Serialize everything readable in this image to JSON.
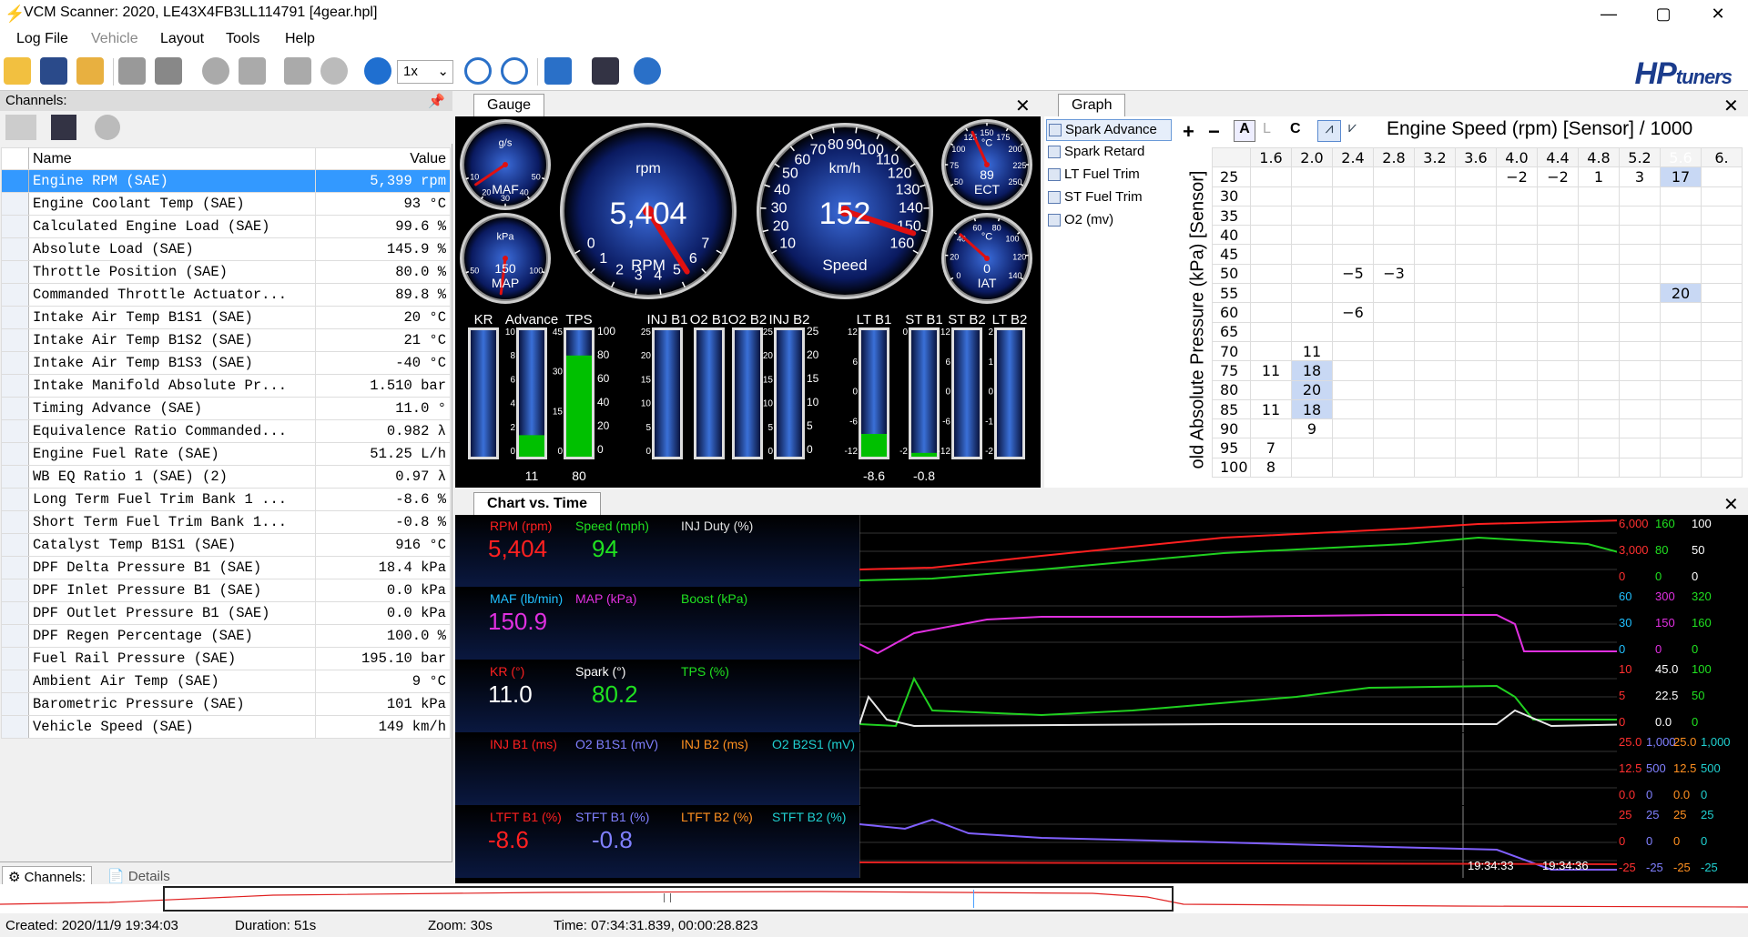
{
  "window": {
    "title": "VCM Scanner: 2020, LE43X4FB3LL114791 [4gear.hpl]",
    "minimize": "—",
    "maximize": "▢",
    "close": "✕"
  },
  "menu": [
    "Log File",
    "Vehicle",
    "Layout",
    "Tools",
    "Help"
  ],
  "toolbar": {
    "speed": "1x",
    "logo_hp": "HP",
    "logo_tuners": "tuners"
  },
  "channels": {
    "header": "Channels:",
    "col_name": "Name",
    "col_value": "Value",
    "rows": [
      {
        "name": "Engine RPM (SAE)",
        "value": "5,399 rpm"
      },
      {
        "name": "Engine Coolant Temp (SAE)",
        "value": "93 °C"
      },
      {
        "name": "Calculated Engine Load (SAE)",
        "value": "99.6 %"
      },
      {
        "name": "Absolute Load (SAE)",
        "value": "145.9 %"
      },
      {
        "name": "Throttle Position (SAE)",
        "value": "80.0 %"
      },
      {
        "name": "Commanded Throttle Actuator...",
        "value": "89.8 %"
      },
      {
        "name": "Intake Air Temp B1S1 (SAE)",
        "value": "20 °C"
      },
      {
        "name": "Intake Air Temp B1S2 (SAE)",
        "value": "21 °C"
      },
      {
        "name": "Intake Air Temp B1S3 (SAE)",
        "value": "-40 °C"
      },
      {
        "name": "Intake Manifold Absolute Pr...",
        "value": "1.510 bar"
      },
      {
        "name": "Timing Advance (SAE)",
        "value": "11.0 °"
      },
      {
        "name": "Equivalence Ratio Commanded...",
        "value": "0.982 λ"
      },
      {
        "name": "Engine Fuel Rate (SAE)",
        "value": "51.25 L/h"
      },
      {
        "name": "WB EQ Ratio 1 (SAE) (2)",
        "value": "0.97 λ"
      },
      {
        "name": "Long Term Fuel Trim Bank 1 ...",
        "value": "-8.6 %"
      },
      {
        "name": "Short Term Fuel Trim Bank 1...",
        "value": "-0.8 %"
      },
      {
        "name": "Catalyst Temp B1S1 (SAE)",
        "value": "916 °C"
      },
      {
        "name": "DPF Delta Pressure B1 (SAE)",
        "value": "18.4 kPa"
      },
      {
        "name": "DPF Inlet Pressure B1 (SAE)",
        "value": "0.0 kPa"
      },
      {
        "name": "DPF Outlet Pressure B1 (SAE)",
        "value": "0.0 kPa"
      },
      {
        "name": "DPF Regen Percentage (SAE)",
        "value": "100.0 %"
      },
      {
        "name": "Fuel Rail Pressure (SAE)",
        "value": "195.10 bar"
      },
      {
        "name": "Ambient Air Temp (SAE)",
        "value": "9 °C"
      },
      {
        "name": "Barometric Pressure (SAE)",
        "value": "101 kPa"
      },
      {
        "name": "Vehicle Speed (SAE)",
        "value": "149 km/h"
      }
    ],
    "tab_channels": "Channels:",
    "tab_details": "Details"
  },
  "gauge": {
    "tab": "Gauge",
    "close": "✕",
    "maf": {
      "unit": "g/s",
      "label": "MAF",
      "ticks": [
        "10",
        "20",
        "30",
        "40",
        "50"
      ]
    },
    "map": {
      "unit": "kPa",
      "label": "MAP",
      "value": "150",
      "ticks": [
        "50",
        "100"
      ]
    },
    "rpm": {
      "unit": "rpm",
      "label": "RPM",
      "value": "5,404",
      "ticks": [
        "0",
        "1",
        "2",
        "3",
        "4",
        "5",
        "6",
        "7"
      ],
      "fraction": 0.772
    },
    "speed": {
      "unit": "km/h",
      "label": "Speed",
      "value": "152",
      "ticks": [
        "10",
        "20",
        "30",
        "40",
        "50",
        "60",
        "70",
        "80",
        "90",
        "100",
        "110",
        "120",
        "130",
        "140",
        "150",
        "160"
      ],
      "fraction": 0.95
    },
    "ect": {
      "unit": "°C",
      "label": "ECT",
      "value": "89",
      "ticks": [
        "50",
        "75",
        "100",
        "125",
        "150",
        "175",
        "200",
        "225",
        "250"
      ]
    },
    "iat": {
      "unit": "°C",
      "label": "IAT",
      "value": "0",
      "ticks": [
        "0",
        "20",
        "40",
        "60",
        "80",
        "100",
        "120",
        "140"
      ]
    },
    "bars": [
      {
        "label": "KR",
        "fill": 0.0,
        "color": "#00b000",
        "ticks": [],
        "value": ""
      },
      {
        "label": "Advance",
        "fill": 0.17,
        "color": "#00c000",
        "ticks": [
          "10",
          "8",
          "6",
          "4",
          "2",
          "0"
        ],
        "value": "11"
      },
      {
        "label": "TPS",
        "fill": 0.8,
        "color": "#00c000",
        "ticks": [
          "45",
          "30",
          "15",
          "0"
        ],
        "value": "80"
      },
      {
        "label": "INJ B1",
        "fill": 0.0,
        "color": "#00b000",
        "ticks": [
          "25",
          "20",
          "15",
          "10",
          "5",
          "0"
        ],
        "value": ""
      },
      {
        "label": "O2 B1",
        "fill": 0.0,
        "color": "#00b000",
        "ticks": [],
        "value": ""
      },
      {
        "label": "O2 B2",
        "fill": 0.0,
        "color": "#00b000",
        "ticks": [],
        "value": ""
      },
      {
        "label": "INJ B2",
        "fill": 0.0,
        "color": "#00b000",
        "ticks": [
          "25",
          "20",
          "15",
          "10",
          "5",
          "0"
        ],
        "value": ""
      },
      {
        "label": "LT B1",
        "fill": 0.18,
        "color": "#00c000",
        "ticks": [
          "12",
          "6",
          "0",
          "-6",
          "-12"
        ],
        "value": "-8.6"
      },
      {
        "label": "ST B1",
        "fill": 0.03,
        "color": "#00c000",
        "ticks": [
          "0",
          "-2"
        ],
        "value": "-0.8"
      },
      {
        "label": "ST B2",
        "fill": 0.0,
        "color": "#00b000",
        "ticks": [
          "12",
          "6",
          "0",
          "-6",
          "-12"
        ],
        "value": ""
      },
      {
        "label": "LT B2",
        "fill": 0.0,
        "color": "#00b000",
        "ticks": [
          "2",
          "1",
          "0",
          "-1",
          "-2"
        ],
        "value": ""
      }
    ],
    "scale_extra": {
      "adv_right": [
        "100",
        "80",
        "60",
        "40",
        "20",
        "0"
      ],
      "tps_right": [
        "100",
        "80",
        "60",
        "40",
        "20",
        "0"
      ],
      "lt_right": [
        "25",
        "20",
        "15",
        "10",
        "5",
        "0"
      ]
    }
  },
  "graph": {
    "tab": "Graph",
    "close": "✕",
    "items": [
      "Spark Advance",
      "Spark Retard",
      "LT Fuel Trim",
      "ST Fuel Trim",
      "O2 (mv)"
    ],
    "tools": [
      "+",
      "−",
      "A",
      "L",
      "C"
    ],
    "title": "Engine Speed (rpm) [Sensor] / 1000",
    "ylabel": "old Absolute Pressure (kPa) [Sensor]",
    "cols": [
      "1.6",
      "2.0",
      "2.4",
      "2.8",
      "3.2",
      "3.6",
      "4.0",
      "4.4",
      "4.8",
      "5.2",
      "5.6",
      "6."
    ],
    "rows": [
      {
        "k": "25",
        "v": [
          "",
          "",
          "",
          "",
          "",
          "",
          "−2",
          "−2",
          "1",
          "3",
          "17",
          ""
        ]
      },
      {
        "k": "30",
        "v": [
          "",
          "",
          "",
          "",
          "",
          "",
          "",
          "",
          "",
          "",
          "",
          ""
        ]
      },
      {
        "k": "35",
        "v": [
          "",
          "",
          "",
          "",
          "",
          "",
          "",
          "",
          "",
          "",
          "",
          ""
        ]
      },
      {
        "k": "40",
        "v": [
          "",
          "",
          "",
          "",
          "",
          "",
          "",
          "",
          "",
          "",
          "",
          ""
        ]
      },
      {
        "k": "45",
        "v": [
          "",
          "",
          "",
          "",
          "",
          "",
          "",
          "",
          "",
          "",
          "",
          ""
        ]
      },
      {
        "k": "50",
        "v": [
          "",
          "",
          "−5",
          "−3",
          "",
          "",
          "",
          "",
          "",
          "",
          "",
          ""
        ]
      },
      {
        "k": "55",
        "v": [
          "",
          "",
          "",
          "",
          "",
          "",
          "",
          "",
          "",
          "",
          "20",
          ""
        ]
      },
      {
        "k": "60",
        "v": [
          "",
          "",
          "−6",
          "",
          "",
          "",
          "",
          "",
          "",
          "",
          "",
          ""
        ]
      },
      {
        "k": "65",
        "v": [
          "",
          "",
          "",
          "",
          "",
          "",
          "",
          "",
          "",
          "",
          "",
          ""
        ]
      },
      {
        "k": "70",
        "v": [
          "",
          "11",
          "",
          "",
          "",
          "",
          "",
          "",
          "",
          "",
          "",
          ""
        ]
      },
      {
        "k": "75",
        "v": [
          "11",
          "18",
          "",
          "",
          "",
          "",
          "",
          "",
          "",
          "",
          "",
          ""
        ]
      },
      {
        "k": "80",
        "v": [
          "",
          "20",
          "",
          "",
          "",
          "",
          "",
          "",
          "",
          "",
          "",
          ""
        ]
      },
      {
        "k": "85",
        "v": [
          "11",
          "18",
          "",
          "",
          "",
          "",
          "",
          "",
          "",
          "",
          "",
          ""
        ]
      },
      {
        "k": "90",
        "v": [
          "",
          "9",
          "",
          "",
          "",
          "",
          "",
          "",
          "",
          "",
          "",
          ""
        ]
      },
      {
        "k": "95",
        "v": [
          "7",
          "",
          "",
          "",
          "",
          "",
          "",
          "",
          "",
          "",
          "",
          ""
        ]
      },
      {
        "k": "100",
        "v": [
          "8",
          "",
          "",
          "",
          "",
          "",
          "",
          "",
          "",
          "",
          "",
          ""
        ]
      }
    ]
  },
  "chart": {
    "tab": "Chart vs. Time",
    "close": "✕",
    "strips": [
      {
        "labels": [
          {
            "t": "RPM (rpm)",
            "c": "#ff2020"
          },
          {
            "t": "Speed (mph)",
            "c": "#20e020"
          },
          {
            "t": "INJ Duty (%)",
            "c": "#e0e0e0"
          }
        ],
        "values": [
          {
            "t": "5,404",
            "c": "#ff2020"
          },
          {
            "t": "94",
            "c": "#20e020"
          }
        ],
        "scale": [
          [
            "6,000",
            "#ff3030"
          ],
          [
            "160",
            "#20e020"
          ],
          [
            "100",
            "#fff"
          ],
          [
            "3,000",
            "#ff3030"
          ],
          [
            "80",
            "#20e020"
          ],
          [
            "50",
            "#fff"
          ],
          [
            "0",
            "#ff3030"
          ],
          [
            "0",
            "#20e020"
          ],
          [
            "0",
            "#fff"
          ]
        ]
      },
      {
        "labels": [
          {
            "t": "MAF (lb/min)",
            "c": "#20c0ff"
          },
          {
            "t": "MAP (kPa)",
            "c": "#e030e0"
          },
          {
            "t": "Boost (kPa)",
            "c": "#20e020"
          }
        ],
        "values": [
          {
            "t": "150.9",
            "c": "#e030e0"
          }
        ],
        "scale": [
          [
            "60",
            "#20c0ff"
          ],
          [
            "300",
            "#e030e0"
          ],
          [
            "320",
            "#20e020"
          ],
          [
            "30",
            "#20c0ff"
          ],
          [
            "150",
            "#e030e0"
          ],
          [
            "160",
            "#20e020"
          ],
          [
            "0",
            "#20c0ff"
          ],
          [
            "0",
            "#e030e0"
          ],
          [
            "0",
            "#20e020"
          ]
        ]
      },
      {
        "labels": [
          {
            "t": "KR (°)",
            "c": "#ff2020"
          },
          {
            "t": "Spark (°)",
            "c": "#ffffff"
          },
          {
            "t": "TPS (%)",
            "c": "#20e020"
          }
        ],
        "values": [
          {
            "t": "11.0",
            "c": "#ffffff"
          },
          {
            "t": "80.2",
            "c": "#20e020"
          }
        ],
        "scale": [
          [
            "10",
            "#ff3030"
          ],
          [
            "45.0",
            "#fff"
          ],
          [
            "100",
            "#20e020"
          ],
          [
            "5",
            "#ff3030"
          ],
          [
            "22.5",
            "#fff"
          ],
          [
            "50",
            "#20e020"
          ],
          [
            "0",
            "#ff3030"
          ],
          [
            "0.0",
            "#fff"
          ],
          [
            "0",
            "#20e020"
          ]
        ]
      },
      {
        "labels": [
          {
            "t": "INJ B1 (ms)",
            "c": "#ff2020"
          },
          {
            "t": "O2 B1S1 (mV)",
            "c": "#8080ff"
          },
          {
            "t": "INJ B2 (ms)",
            "c": "#ff9020"
          },
          {
            "t": "O2 B2S1 (mV)",
            "c": "#20d0d0"
          }
        ],
        "values": [],
        "scale": [
          [
            "25.0",
            "#ff3030"
          ],
          [
            "1,000",
            "#8080ff"
          ],
          [
            "25.0",
            "#ff9020"
          ],
          [
            "1,000",
            "#20d0d0"
          ],
          [
            "12.5",
            "#ff3030"
          ],
          [
            "500",
            "#8080ff"
          ],
          [
            "12.5",
            "#ff9020"
          ],
          [
            "500",
            "#20d0d0"
          ],
          [
            "0.0",
            "#ff3030"
          ],
          [
            "0",
            "#8080ff"
          ],
          [
            "0.0",
            "#ff9020"
          ],
          [
            "0",
            "#20d0d0"
          ]
        ]
      },
      {
        "labels": [
          {
            "t": "LTFT B1 (%)",
            "c": "#ff2020"
          },
          {
            "t": "STFT B1 (%)",
            "c": "#8080ff"
          },
          {
            "t": "LTFT B2 (%)",
            "c": "#ff9020"
          },
          {
            "t": "STFT B2 (%)",
            "c": "#20d0d0"
          }
        ],
        "values": [
          {
            "t": "-8.6",
            "c": "#ff2020"
          },
          {
            "t": "-0.8",
            "c": "#8080ff"
          }
        ],
        "scale": [
          [
            "25",
            "#ff3030"
          ],
          [
            "25",
            "#8080ff"
          ],
          [
            "25",
            "#ff9020"
          ],
          [
            "25",
            "#20d0d0"
          ],
          [
            "0",
            "#ff3030"
          ],
          [
            "0",
            "#8080ff"
          ],
          [
            "0",
            "#ff9020"
          ],
          [
            "0",
            "#20d0d0"
          ],
          [
            "-25",
            "#ff3030"
          ],
          [
            "-25",
            "#8080ff"
          ],
          [
            "-25",
            "#ff9020"
          ],
          [
            "-25",
            "#20d0d0"
          ]
        ]
      }
    ],
    "time_labels": [
      "19:34:33",
      "19:34:36"
    ]
  },
  "status": {
    "created": "Created: 2020/11/9 19:34:03",
    "duration": "Duration: 51s",
    "zoom": "Zoom: 30s",
    "time": "Time: 07:34:31.839, 00:00:28.823"
  }
}
